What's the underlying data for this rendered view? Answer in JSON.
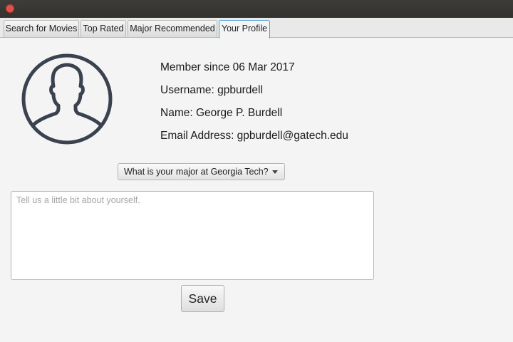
{
  "window": {
    "close_icon": "close-icon"
  },
  "tabs": [
    {
      "label": "Search for Movies",
      "active": false
    },
    {
      "label": "Top Rated",
      "active": false
    },
    {
      "label": "Major Recommended",
      "active": false
    },
    {
      "label": "Your Profile",
      "active": true
    }
  ],
  "profile": {
    "avatar_icon": "user-silhouette-icon",
    "member_since": "Member since 06 Mar 2017",
    "username": "Username: gpburdell",
    "name": "Name: George P. Burdell",
    "email": "Email Address: gpburdell@gatech.edu",
    "major_select": {
      "selected": "What is your major at Georgia Tech?"
    },
    "bio": {
      "value": "",
      "placeholder": "Tell us a little bit about yourself."
    },
    "save_label": "Save"
  },
  "colors": {
    "titlebar": "#3a3835",
    "close_button": "#e2504c",
    "active_tab_border": "#3f9fd5",
    "avatar_stroke": "#3a424f"
  }
}
